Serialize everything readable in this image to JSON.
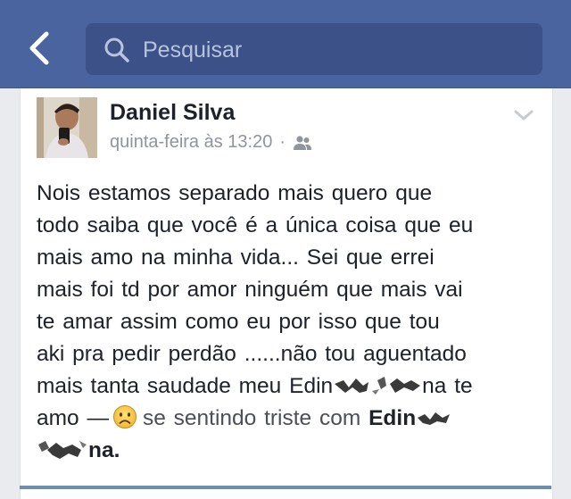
{
  "header": {
    "search_placeholder": "Pesquisar",
    "icons": {
      "back": "chevron-left-icon",
      "search": "search-icon"
    }
  },
  "post": {
    "author": "Daniel Silva",
    "timestamp": "quinta-feira às 13:20",
    "separator": "·",
    "audience_icon": "friends-icon",
    "menu_icon": "chevron-down-icon",
    "lines": [
      "Nois estamos  separado  mais quero que",
      "todo  saiba que você é a única  coisa que eu",
      "mais amo  na minha  vida... Sei que errei",
      "mais foi td por amor ninguém  que mais vai",
      "te amar  assim  como  eu  por isso  que tou",
      "aki pra pedir  perdão ......não tou aguentado"
    ],
    "line7_before": "mais tanta saudade  meu Edin",
    "line7_after": "na te",
    "line8_before": "amo —",
    "feeling_text": "se sentindo triste com",
    "tagged_prefix": "Edin",
    "line9_suffix": "na."
  },
  "colors": {
    "header_bg": "#4a64a0",
    "search_bg": "#3b5187",
    "page_bg": "#e9ebee",
    "text": "#1d2129",
    "meta": "#90949c"
  }
}
